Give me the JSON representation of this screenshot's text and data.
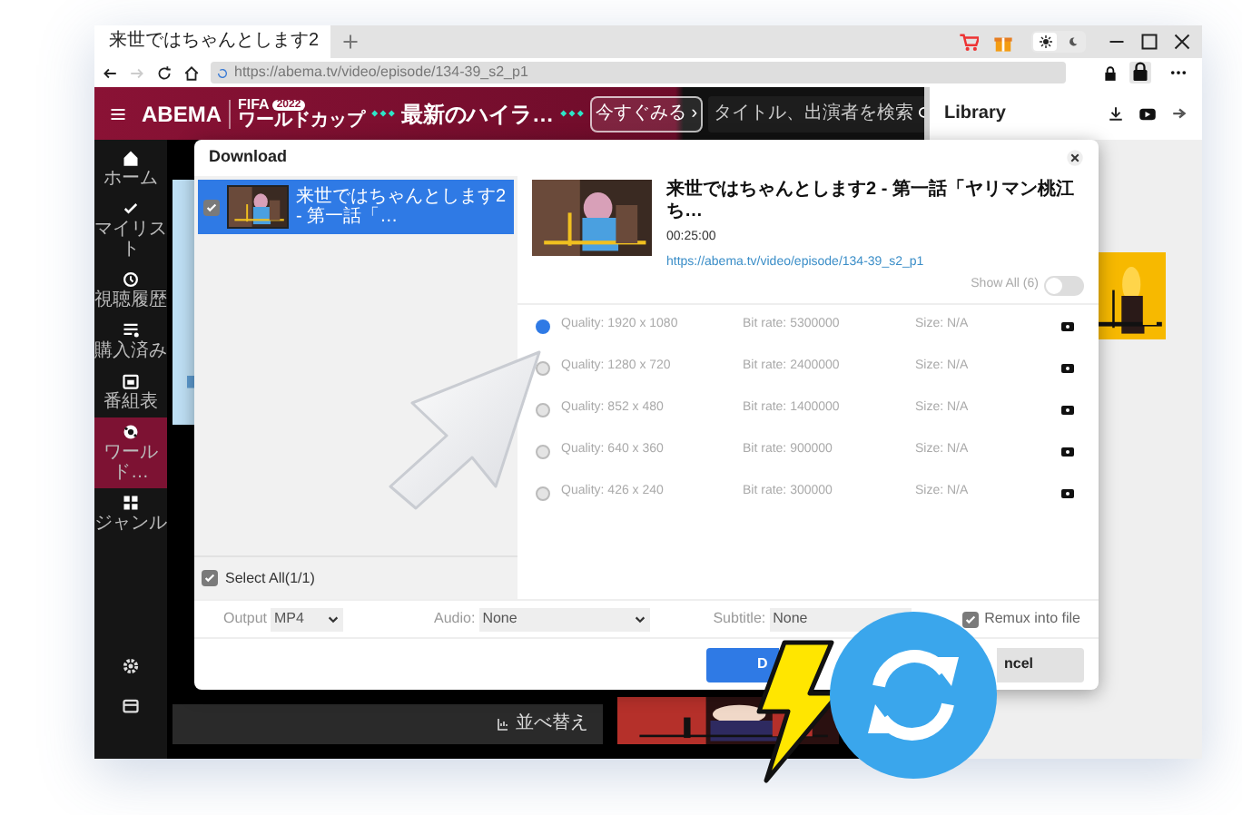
{
  "browser": {
    "tab": {
      "title": "来世ではちゃんとします2",
      "selected": true
    },
    "address": "https://abema.tv/video/episode/134-39_s2_p1",
    "theme_toggle": {
      "dark": false
    }
  },
  "site_header": {
    "logo": "ABEMA",
    "promo_top": "FIFA",
    "promo_badge": "2022",
    "promo_bottom": "ワールドカップ",
    "banner": "最新のハイラ…",
    "watch_button": "今すぐみる ›",
    "search_placeholder": "タイトル、出演者を検索"
  },
  "sidebar": {
    "items": [
      {
        "label": "ホーム",
        "selected": false
      },
      {
        "label": "マイリスト",
        "selected": false
      },
      {
        "label": "視聴履歴",
        "selected": false
      },
      {
        "label": "購入済み",
        "selected": false
      },
      {
        "label": "番組表",
        "selected": false
      },
      {
        "label": "ワールド…",
        "selected": true
      },
      {
        "label": "ジャンル",
        "selected": false
      }
    ]
  },
  "library": {
    "title": "Library"
  },
  "sort_button": "並べ替え",
  "dialog": {
    "title": "Download",
    "items": [
      {
        "title": "来世ではちゃんとします2 - 第一話「…",
        "checked": true,
        "selected": true
      }
    ],
    "video": {
      "title": "来世ではちゃんとします2 - 第一話「ヤリマン桃江ち…",
      "duration": "00:25:00",
      "url": "https://abema.tv/video/episode/134-39_s2_p1"
    },
    "show_all": {
      "label": "Show All (6)",
      "on": false
    },
    "qualities": [
      {
        "quality": "Quality: 1920 x 1080",
        "bitrate": "Bit rate: 5300000",
        "size": "Size: N/A",
        "selected": true
      },
      {
        "quality": "Quality: 1280 x 720",
        "bitrate": "Bit rate: 2400000",
        "size": "Size: N/A",
        "selected": false
      },
      {
        "quality": "Quality: 852 x 480",
        "bitrate": "Bit rate: 1400000",
        "size": "Size: N/A",
        "selected": false
      },
      {
        "quality": "Quality: 640 x 360",
        "bitrate": "Bit rate: 900000",
        "size": "Size: N/A",
        "selected": false
      },
      {
        "quality": "Quality: 426 x 240",
        "bitrate": "Bit rate: 300000",
        "size": "Size: N/A",
        "selected": false
      }
    ],
    "select_all": {
      "label": "Select All(1/1)",
      "checked": true
    },
    "output": {
      "label": "Output",
      "value": "MP4"
    },
    "audio": {
      "label": "Audio:",
      "value": "None"
    },
    "subtitle": {
      "label": "Subtitle:",
      "value": "None"
    },
    "remux": {
      "label": "Remux into file",
      "checked": true
    },
    "buttons": [
      {
        "label": "D",
        "kind": "primary"
      },
      {
        "label": "ncel",
        "kind": "secondary"
      }
    ]
  }
}
